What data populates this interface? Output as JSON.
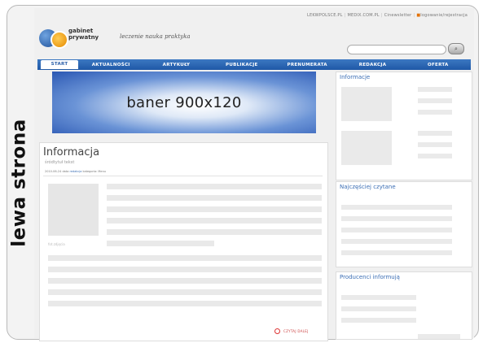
{
  "side_label": "lewa strona",
  "header": {
    "top_links": [
      "LEKWPOLSCE.PL",
      "MEDIX.COM.PL",
      "Cinewsletter",
      "logowanie/rejestracja"
    ],
    "logo_line1": "gabinet",
    "logo_line2": "prywatny",
    "tagline": "leczenie nauka praktyka"
  },
  "nav": {
    "items": [
      "START",
      "AKTUALNOŚCI",
      "ARTYKUŁY",
      "PUBLIKACJE",
      "PRENUMERATA",
      "REDAKCJA",
      "OFERTA"
    ]
  },
  "banner": {
    "text": "baner 900x120"
  },
  "article": {
    "title": "Informacja",
    "subtitle": "śródtytuł tekst",
    "meta_date": "2010-06-24 data",
    "meta_author": "redakcja",
    "meta_category": "kategoria: Menu",
    "caption": "fot.zdjęcia",
    "read_more": "CZYTAJ DALEJ"
  },
  "sidebar": {
    "box1_title": "Informacje",
    "box2_title": "Najczęściej czytane",
    "box3_title": "Producenci informują"
  },
  "colors": {
    "nav": "#1f58a6",
    "accent_link": "#3c6fb5",
    "read_more": "#d33333"
  }
}
